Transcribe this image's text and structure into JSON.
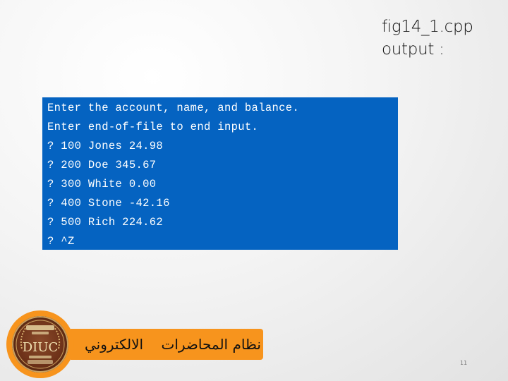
{
  "slide": {
    "title_lines": [
      "fig14_1.cpp",
      "output :"
    ],
    "page_number": "11"
  },
  "console": {
    "background_color": "#0563c1",
    "text_color": "#ffffff",
    "lines": [
      "Enter the account, name, and balance.",
      "Enter end-of-file to end input.",
      "? 100 Jones 24.98",
      "? 200 Doe 345.67",
      "? 300 White 0.00",
      "? 400 Stone -42.16",
      "? 500 Rich 224.62",
      "? ^Z"
    ]
  },
  "footer": {
    "banner_text": "نظام المحاضرات    الالكتروني",
    "banner_color": "#f7941d",
    "logo": {
      "icon": "university-seal-icon",
      "letters": "DIUC"
    }
  }
}
